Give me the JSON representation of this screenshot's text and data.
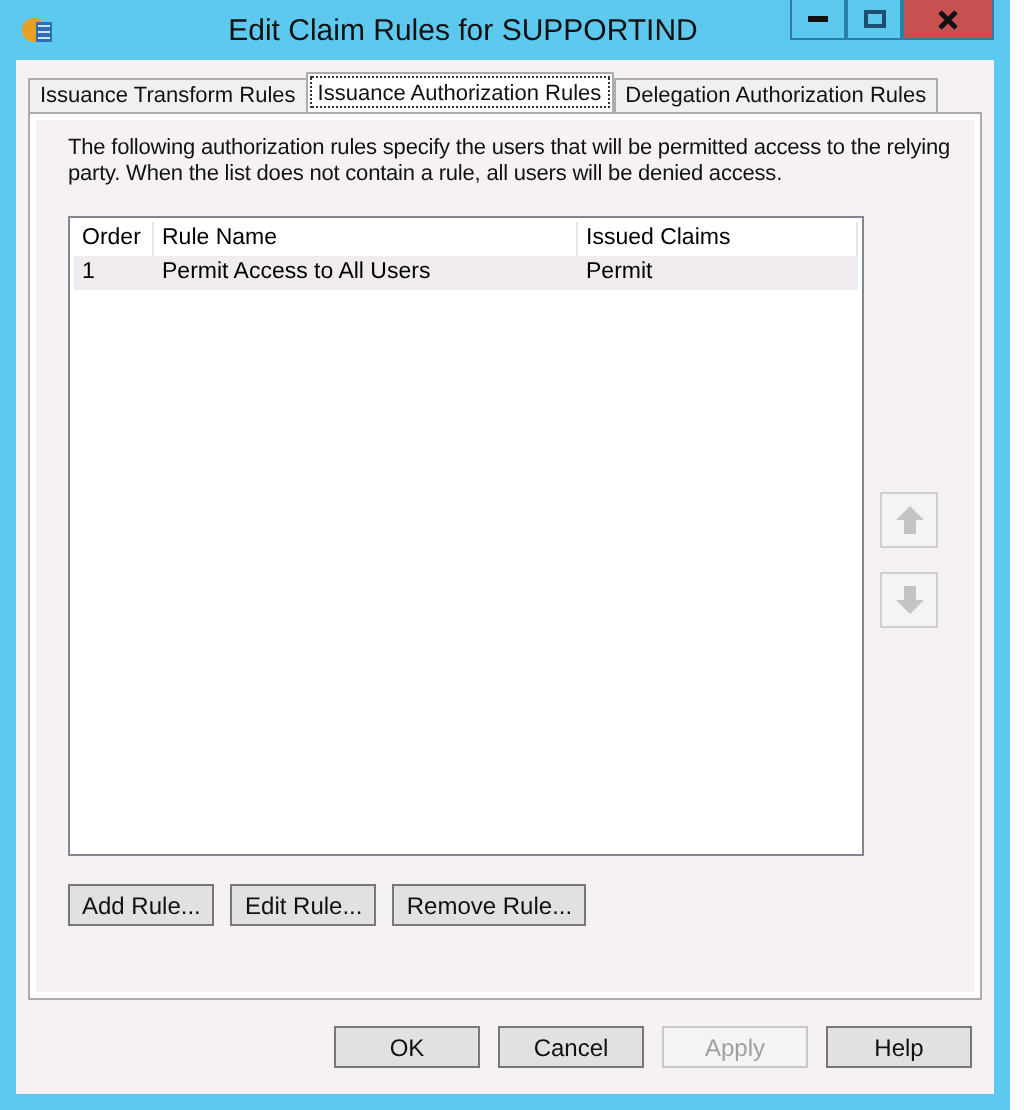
{
  "window": {
    "title": "Edit Claim Rules for SUPPORTIND"
  },
  "tabs": [
    {
      "label": "Issuance Transform Rules",
      "selected": false
    },
    {
      "label": "Issuance Authorization Rules",
      "selected": true
    },
    {
      "label": "Delegation Authorization Rules",
      "selected": false
    }
  ],
  "description": "The following authorization rules specify the users that will be permitted access to the relying party. When the list does not contain a rule, all users will be denied access.",
  "table": {
    "columns": [
      "Order",
      "Rule Name",
      "Issued Claims"
    ],
    "rows": [
      {
        "cells": [
          "1",
          "Permit Access to All Users",
          "Permit"
        ],
        "selected": true
      }
    ]
  },
  "move_buttons": [
    {
      "kind": "up",
      "disabled": true
    },
    {
      "kind": "down",
      "disabled": true
    }
  ],
  "rule_buttons": [
    {
      "label": "Add Rule..."
    },
    {
      "label": "Edit Rule..."
    },
    {
      "label": "Remove Rule..."
    }
  ],
  "dialog_buttons": [
    {
      "label": "OK",
      "disabled": false
    },
    {
      "label": "Cancel",
      "disabled": false
    },
    {
      "label": "Apply",
      "disabled": true
    },
    {
      "label": "Help",
      "disabled": false
    }
  ]
}
